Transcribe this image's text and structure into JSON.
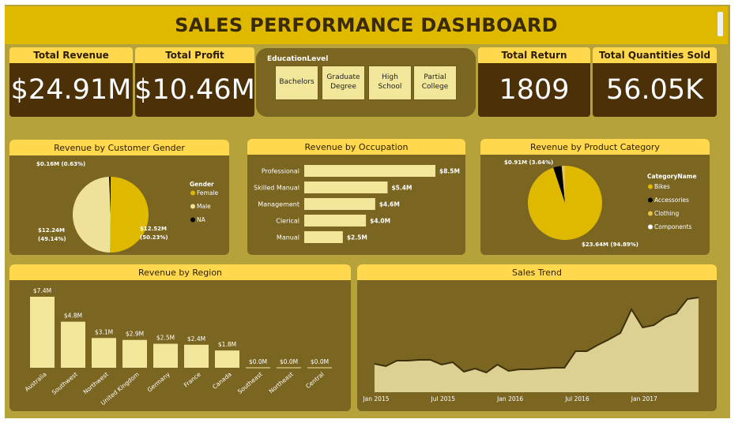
{
  "title": "SALES PERFORMANCE DASHBOARD",
  "kpis": {
    "revenue": {
      "label": "Total Revenue",
      "value": "$24.91M"
    },
    "profit": {
      "label": "Total Profit",
      "value": "$10.46M"
    },
    "return": {
      "label": "Total Return",
      "value": "1809"
    },
    "quantity": {
      "label": "Total Quantities Sold",
      "value": "56.05K"
    }
  },
  "slicer": {
    "title": "EducationLevel",
    "options": [
      "Bachelors",
      "Graduate Degree",
      "High School",
      "Partial College"
    ]
  },
  "colors": {
    "board": "#b6a23a",
    "panel": "#7a6521",
    "header": "#ffd84d",
    "bar": "#f2e69a",
    "kpi_bg": "#4b3008",
    "female": "#dfb800",
    "male": "#efe09a",
    "na": "#000000"
  },
  "chart_data": [
    {
      "type": "pie",
      "title": "Revenue by Customer Gender",
      "legend_title": "Gender",
      "legend_position": "right",
      "labels": [
        "Female",
        "Male",
        "NA"
      ],
      "values": [
        12.52,
        12.24,
        0.16
      ],
      "data_labels": [
        "$12.52M (50.23%)",
        "$12.24M (49.14%)",
        "$0.16M (0.63%)"
      ],
      "colors": [
        "#dfb800",
        "#efe09a",
        "#000000"
      ]
    },
    {
      "type": "bar",
      "orientation": "horizontal",
      "title": "Revenue by Occupation",
      "categories": [
        "Professional",
        "Skilled Manual",
        "Management",
        "Clerical",
        "Manual"
      ],
      "values": [
        8.5,
        5.4,
        4.6,
        4.0,
        2.5
      ],
      "data_labels": [
        "$8.5M",
        "$5.4M",
        "$4.6M",
        "$4.0M",
        "$2.5M"
      ]
    },
    {
      "type": "pie",
      "title": "Revenue by Product Category",
      "legend_title": "CategoryName",
      "legend_position": "right",
      "labels": [
        "Bikes",
        "Accessories",
        "Clothing",
        "Components"
      ],
      "values": [
        23.64,
        0.91,
        0.36,
        0.0
      ],
      "data_labels": [
        "$23.64M (94.89%)",
        "$0.91M (3.64%)"
      ],
      "colors": [
        "#dfb800",
        "#000000",
        "#e6c44a",
        "#ffffff"
      ]
    },
    {
      "type": "bar",
      "title": "Revenue by Region",
      "categories": [
        "Australia",
        "Southwest",
        "Northwest",
        "United Kingdom",
        "Germany",
        "France",
        "Canada",
        "Southeast",
        "Northeast",
        "Central"
      ],
      "values": [
        7.4,
        4.8,
        3.1,
        2.9,
        2.5,
        2.4,
        1.8,
        0.0,
        0.0,
        0.0
      ],
      "data_labels": [
        "$7.4M",
        "$4.8M",
        "$3.1M",
        "$2.9M",
        "$2.5M",
        "$2.4M",
        "$1.8M",
        "$0.0M",
        "$0.0M",
        "$0.0M"
      ]
    },
    {
      "type": "area",
      "title": "Sales Trend",
      "x_ticks": [
        "Jan 2015",
        "Jul 2015",
        "Jan 2016",
        "Jul 2016",
        "Jan 2017"
      ],
      "x": [
        "2015-01",
        "2015-02",
        "2015-03",
        "2015-04",
        "2015-05",
        "2015-06",
        "2015-07",
        "2015-08",
        "2015-09",
        "2015-10",
        "2015-11",
        "2015-12",
        "2016-01",
        "2016-02",
        "2016-03",
        "2016-04",
        "2016-05",
        "2016-06",
        "2016-07",
        "2016-08",
        "2016-09",
        "2016-10",
        "2016-11",
        "2016-12",
        "2017-01",
        "2017-02",
        "2017-03",
        "2017-04",
        "2017-05",
        "2017-06"
      ],
      "values": [
        0.36,
        0.33,
        0.4,
        0.4,
        0.41,
        0.41,
        0.35,
        0.38,
        0.26,
        0.3,
        0.25,
        0.35,
        0.27,
        0.29,
        0.29,
        0.3,
        0.31,
        0.31,
        0.52,
        0.52,
        0.6,
        0.67,
        0.75,
        1.05,
        0.82,
        0.85,
        0.95,
        1.0,
        1.18,
        1.2
      ],
      "ylim": [
        0,
        1.4
      ]
    }
  ]
}
